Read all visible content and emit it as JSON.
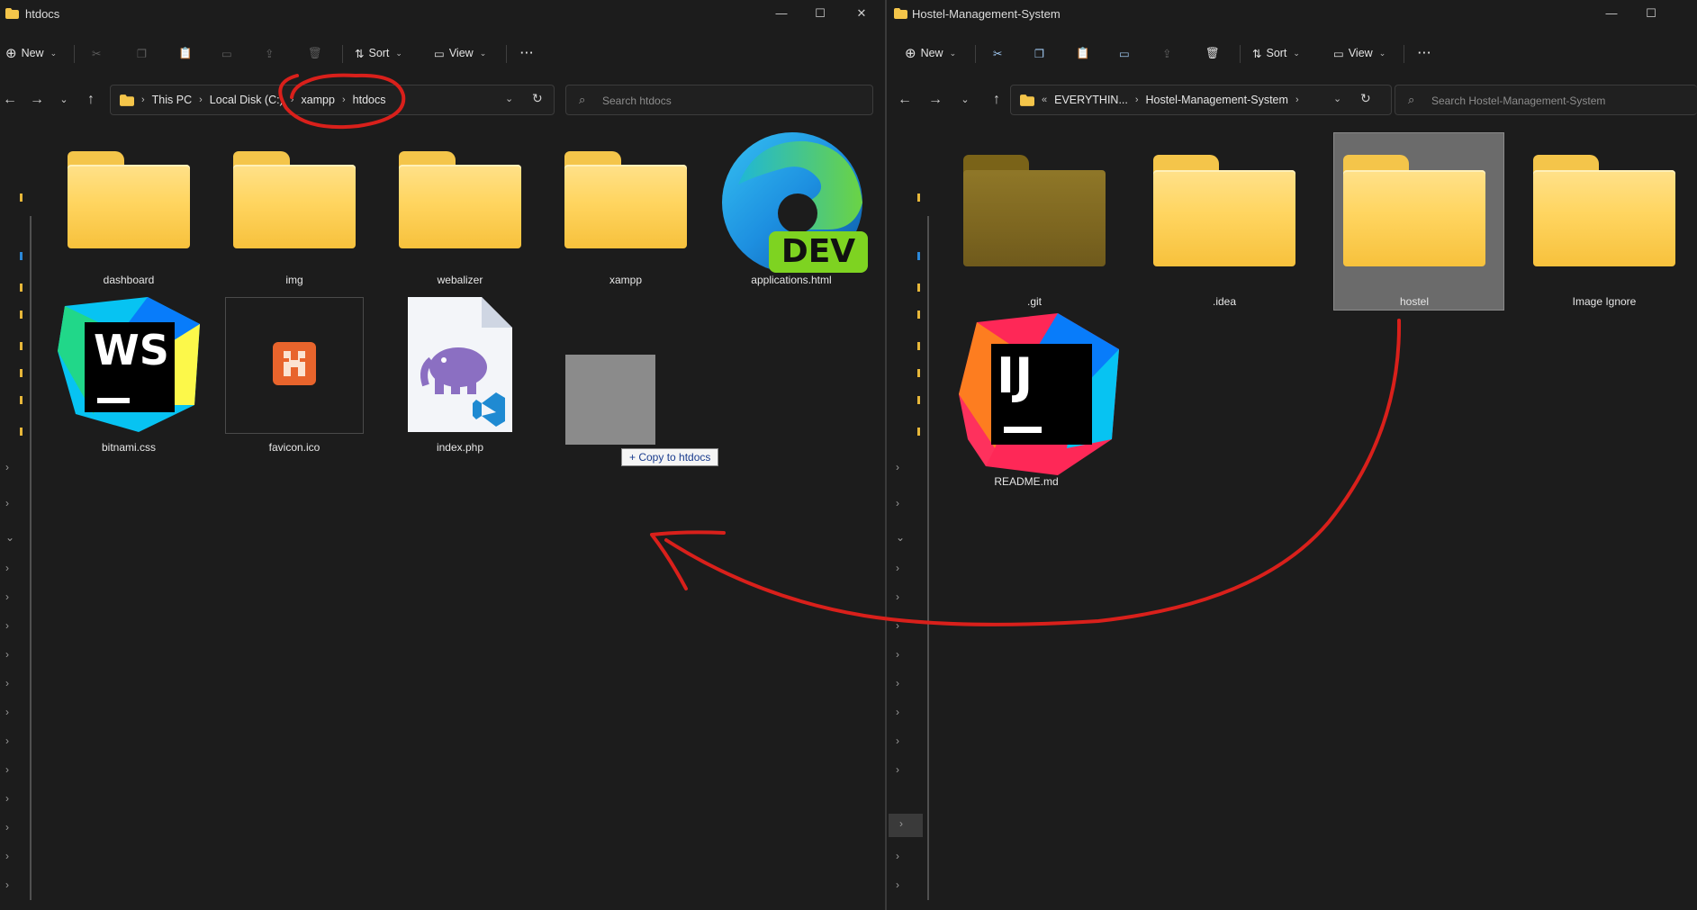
{
  "left_window": {
    "title": "htdocs",
    "toolbar": {
      "new": "New",
      "sort": "Sort",
      "view": "View",
      "more": "···"
    },
    "breadcrumb": [
      "This PC",
      "Local Disk (C:)",
      "xampp",
      "htdocs"
    ],
    "search_placeholder": "Search htdocs",
    "items": [
      {
        "name": "dashboard",
        "type": "folder"
      },
      {
        "name": "img",
        "type": "folder"
      },
      {
        "name": "webalizer",
        "type": "folder"
      },
      {
        "name": "xampp",
        "type": "folder"
      },
      {
        "name": "applications.html",
        "type": "file",
        "icon": "edge-dev-icon"
      },
      {
        "name": "bitnami.css",
        "type": "file",
        "icon": "webstorm-icon"
      },
      {
        "name": "favicon.ico",
        "type": "file",
        "icon": "xampp-icon"
      },
      {
        "name": "index.php",
        "type": "file",
        "icon": "php-vscode-icon"
      }
    ],
    "drag_tooltip": "+ Copy to htdocs"
  },
  "right_window": {
    "title": "Hostel-Management-System",
    "toolbar": {
      "new": "New",
      "sort": "Sort",
      "view": "View",
      "more": "···"
    },
    "breadcrumb": [
      "EVERYTHIN...",
      "Hostel-Management-System"
    ],
    "search_placeholder": "Search Hostel-Management-System",
    "items": [
      {
        "name": ".git",
        "type": "folder",
        "hidden": true
      },
      {
        "name": ".idea",
        "type": "folder"
      },
      {
        "name": "hostel",
        "type": "folder",
        "selected": true
      },
      {
        "name": "Image Ignore",
        "type": "folder"
      },
      {
        "name": "README.md",
        "type": "file",
        "icon": "intellij-icon"
      }
    ]
  },
  "badges": {
    "edge_dev": "DEV",
    "webstorm": "WS",
    "intellij": "IJ"
  },
  "colors": {
    "annotation_red": "#d9201b",
    "folder_yellow": "#ffd560",
    "selection": "#6b6b6b",
    "background": "#1c1c1c"
  }
}
